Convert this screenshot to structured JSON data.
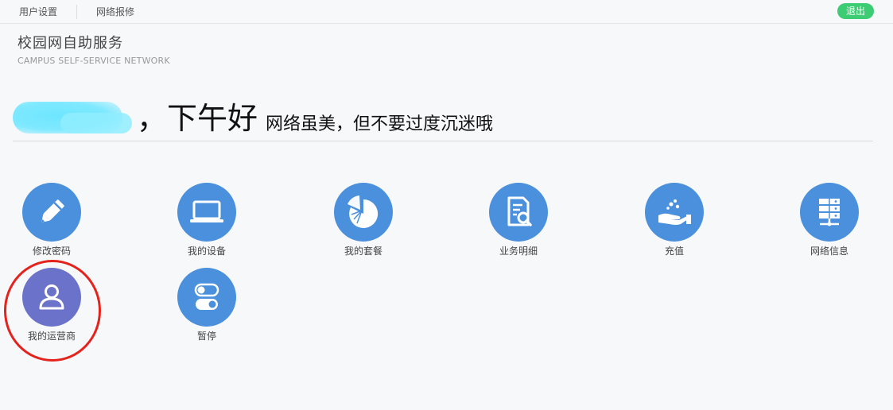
{
  "topbar": {
    "user_settings": "用户设置",
    "network_repair": "网络报修",
    "logout": "退出"
  },
  "brand": {
    "title_cn": "校园网自助服务",
    "title_en": "CAMPUS  SELF-SERVICE NETWORK"
  },
  "greeting": {
    "hello": "，下午好",
    "slogan": "网络虽美，但不要过度沉迷哦"
  },
  "tiles": [
    {
      "label": "修改密码",
      "icon": "pencil-icon"
    },
    {
      "label": "我的设备",
      "icon": "laptop-icon"
    },
    {
      "label": "我的套餐",
      "icon": "pie-chart-icon"
    },
    {
      "label": "业务明细",
      "icon": "document-search-icon"
    },
    {
      "label": "充值",
      "icon": "hand-coins-icon"
    },
    {
      "label": "网络信息",
      "icon": "server-icon"
    },
    {
      "label": "我的运营商",
      "icon": "user-icon"
    },
    {
      "label": "暂停",
      "icon": "toggle-icon"
    }
  ],
  "colors": {
    "tile_blue": "#4a90dc",
    "tile_purple": "#6b72c9",
    "logout_green": "#3ccc73",
    "highlight_red": "#e4231d"
  }
}
